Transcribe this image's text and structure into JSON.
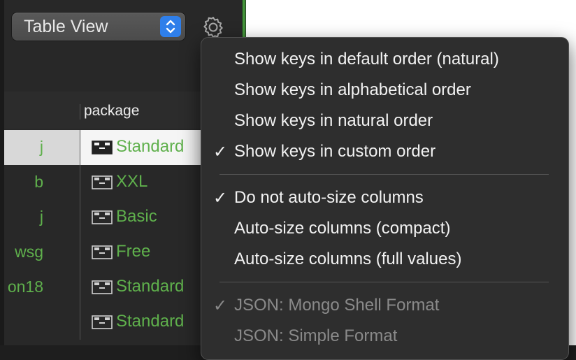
{
  "toolbar": {
    "view_select": {
      "label": "Table View",
      "icon": "chevron-updown-icon"
    },
    "settings_icon": "gear-icon"
  },
  "table": {
    "columns": [
      "package"
    ],
    "rows": [
      {
        "name": "j",
        "package": "Standard",
        "selected": true
      },
      {
        "name": "b",
        "package": "XXL"
      },
      {
        "name": "j",
        "package": "Basic"
      },
      {
        "name": "wsg",
        "package": "Free"
      },
      {
        "name": "on18",
        "package": "Standard"
      },
      {
        "name": "",
        "package": "Standard"
      }
    ]
  },
  "menu": {
    "items": [
      {
        "label": "Show keys in default order (natural)",
        "checked": false,
        "enabled": true
      },
      {
        "label": "Show keys in alphabetical order",
        "checked": false,
        "enabled": true
      },
      {
        "label": "Show keys in natural order",
        "checked": false,
        "enabled": true
      },
      {
        "label": "Show keys in custom order",
        "checked": true,
        "enabled": true
      },
      {
        "label": "Do not auto-size columns",
        "checked": true,
        "enabled": true
      },
      {
        "label": "Auto-size columns (compact)",
        "checked": false,
        "enabled": true
      },
      {
        "label": "Auto-size columns (full values)",
        "checked": false,
        "enabled": true
      },
      {
        "label": "JSON: Mongo Shell Format",
        "checked": true,
        "enabled": false
      },
      {
        "label": "JSON: Simple Format",
        "checked": false,
        "enabled": false
      }
    ],
    "check_glyph": "✓"
  },
  "colors": {
    "accent_blue": "#2f7fea",
    "value_green": "#5fb04c",
    "menu_bg": "#2e2e2e"
  }
}
